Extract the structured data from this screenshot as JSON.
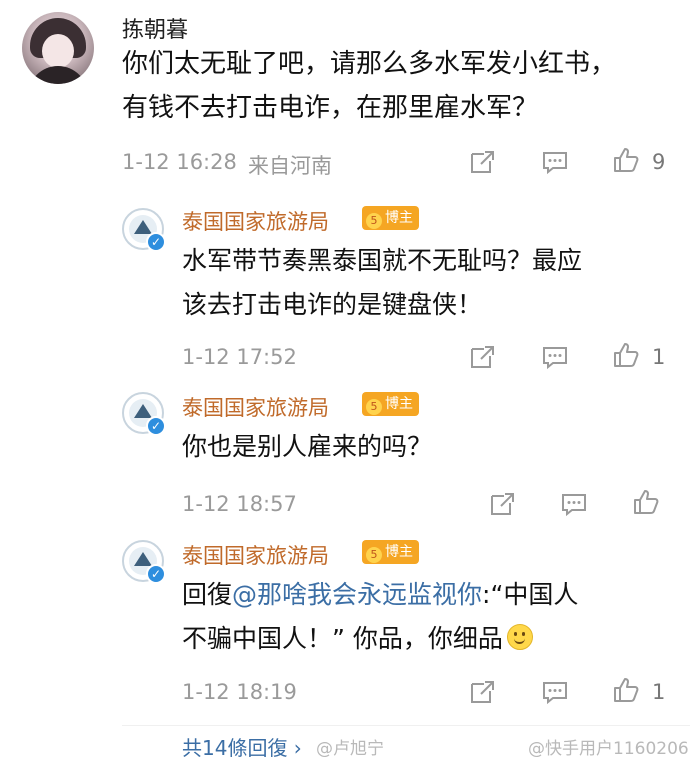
{
  "main_comment": {
    "username": "拣朝暮",
    "content_line1": "你们太无耻了吧，请那么多水军发小红书，",
    "content_line2": "有钱不去打击电诈，在那里雇水军？",
    "timestamp": "1-12 16:28",
    "location": "来自河南",
    "like_count": "9"
  },
  "replies": [
    {
      "username": "泰国国家旅游局",
      "badge": "博主",
      "text_line1": "水军带节奏黑泰国就不无耻吗？最应",
      "text_line2": "该去打击电诈的是键盘侠！",
      "timestamp": "1-12 17:52",
      "like_count": "1"
    },
    {
      "username": "泰国国家旅游局",
      "badge": "博主",
      "text_line1": "你也是别人雇来的吗？",
      "timestamp": "1-12 18:57",
      "like_count": ""
    },
    {
      "username": "泰国国家旅游局",
      "badge": "博主",
      "reply_prefix": "回復",
      "mention": "@那啥我会永远监视你",
      "text_after_mention": ":“中国人",
      "text_line2": "不骗中国人！” 你品，你细品",
      "timestamp": "1-12 18:19",
      "like_count": "1"
    }
  ],
  "more_replies_label": "共14條回復",
  "watermark_left": "@卢旭宁",
  "watermark_right": "@快手用户1160206",
  "colors": {
    "reply_name": "#c06a2a",
    "mention": "#3b6ea5",
    "badge": "#f5a623",
    "meta": "#9a9a9a"
  },
  "icons": [
    "share-icon",
    "comment-icon",
    "like-icon",
    "verified-icon",
    "smiley-emoji-icon"
  ]
}
